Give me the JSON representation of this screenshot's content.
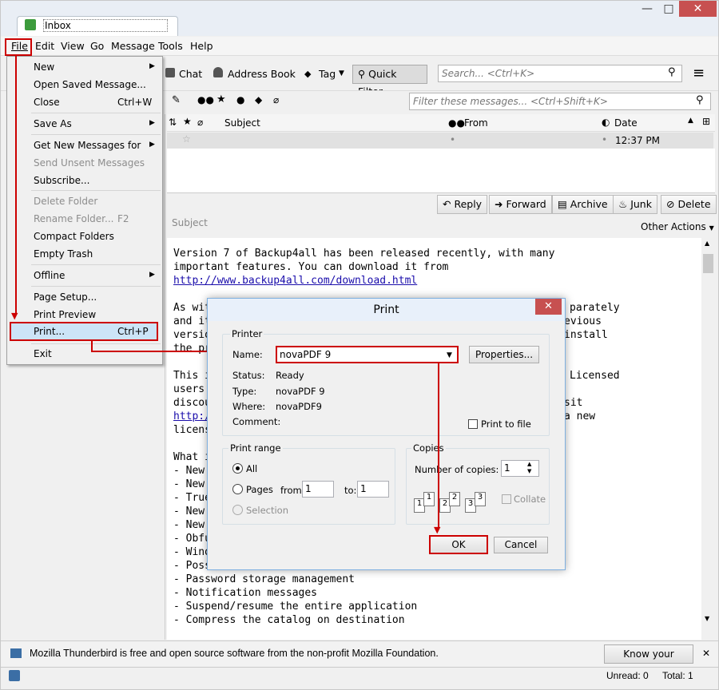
{
  "window": {
    "tab_title": "Inbox",
    "min": "—",
    "max": "□",
    "close": "✕"
  },
  "menubar": {
    "file": "File",
    "edit": "Edit",
    "view": "View",
    "go": "Go",
    "message": "Message",
    "tools": "Tools",
    "help": "Help"
  },
  "toolbar": {
    "chat": "Chat",
    "address_book": "Address Book",
    "tag": "Tag",
    "quick_filter": "Quick Filter",
    "search_placeholder": "Search... <Ctrl+K>"
  },
  "filterbar": {
    "placeholder": "Filter these messages... <Ctrl+Shift+K>"
  },
  "columns": {
    "subject": "Subject",
    "from": "From",
    "date": "Date"
  },
  "message_row": {
    "dot1": "•",
    "dot2": "•",
    "date": "12:37 PM"
  },
  "actions": {
    "reply": "Reply",
    "forward": "Forward",
    "archive": "Archive",
    "junk": "Junk",
    "delete": "Delete",
    "other": "Other Actions"
  },
  "header": {
    "subject_label": "Subject"
  },
  "body_text": {
    "l1": "Version 7 of Backup4all has been released recently, with many",
    "l2": "important features. You can download it from",
    "link": "http://www.backup4all.com/download.html",
    "l4a": "As wit",
    "l4b": "parately",
    "l5a": "and it",
    "l5b": "evious",
    "l6a": "versio",
    "l6b": "install",
    "l7a": "the pr",
    "l9a": "This i",
    "l9b": "Licensed",
    "l10a": "users",
    "l11a": "discou",
    "l11b": "sit",
    "l12a": "http:/",
    "l12b": "a new",
    "l13a": "licens",
    "l15": "What i",
    "l16": "- New",
    "l17": "- New",
    "l18": "- True",
    "l19": "- New",
    "l20": "- New",
    "l21": "- Obfu",
    "l22": "- Wind",
    "l23": "- Poss",
    "l24": "- Password storage management",
    "l25": "- Notification messages",
    "l26": "- Suspend/resume the entire application",
    "l27": "- Compress the catalog on destination"
  },
  "file_menu": {
    "new": "New",
    "open_saved": "Open Saved Message...",
    "close": "Close",
    "close_sc": "Ctrl+W",
    "save_as": "Save As",
    "get_new": "Get New Messages for",
    "send_unsent": "Send Unsent Messages",
    "subscribe": "Subscribe...",
    "delete_folder": "Delete Folder",
    "rename_folder": "Rename Folder...",
    "rename_sc": "F2",
    "compact": "Compact Folders",
    "empty_trash": "Empty Trash",
    "offline": "Offline",
    "page_setup": "Page Setup...",
    "print_preview": "Print Preview",
    "print": "Print...",
    "print_sc": "Ctrl+P",
    "exit": "Exit"
  },
  "print_dialog": {
    "title": "Print",
    "printer_group": "Printer",
    "name_label": "Name:",
    "printer_name": "novaPDF 9",
    "properties": "Properties...",
    "status_label": "Status:",
    "status_val": "Ready",
    "type_label": "Type:",
    "type_val": "novaPDF 9",
    "where_label": "Where:",
    "where_val": "novaPDF9",
    "comment_label": "Comment:",
    "print_to_file": "Print to file",
    "range_group": "Print range",
    "all": "All",
    "pages": "Pages",
    "from_label": "from:",
    "from_val": "1",
    "to_label": "to:",
    "to_val": "1",
    "selection": "Selection",
    "copies_group": "Copies",
    "num_copies": "Number of copies:",
    "copies_val": "1",
    "collate": "Collate",
    "ok": "OK",
    "cancel": "Cancel"
  },
  "notification": {
    "text": "Mozilla Thunderbird is free and open source software from the non-profit Mozilla Foundation.",
    "button": "Know your rights...",
    "close": "✕"
  },
  "statusbar": {
    "unread": "Unread: 0",
    "total": "Total: 1"
  },
  "colors": {
    "highlight": "#cc0000",
    "link": "#1a0dab"
  }
}
